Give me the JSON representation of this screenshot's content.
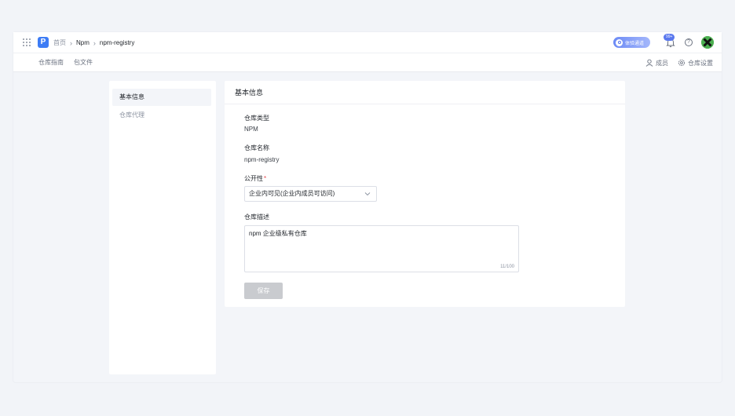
{
  "header": {
    "logo_letter": "P",
    "breadcrumb": [
      "首页",
      "Npm",
      "npm-registry"
    ],
    "pill_label": "体验通道",
    "notification_badge": "99+",
    "help_glyph": "?"
  },
  "tabs": {
    "left": [
      "仓库指南",
      "包文件"
    ],
    "members_label": "成员",
    "settings_label": "仓库设置"
  },
  "sidebar": {
    "items": [
      {
        "label": "基本信息",
        "active": true
      },
      {
        "label": "仓库代理",
        "active": false
      }
    ]
  },
  "main": {
    "title": "基本信息",
    "repo_type_label": "仓库类型",
    "repo_type_value": "NPM",
    "repo_name_label": "仓库名称",
    "repo_name_value": "npm-registry",
    "visibility_label": "公开性",
    "required_mark": "*",
    "visibility_value": "企业内可见(企业内成员可访问)",
    "description_label": "仓库描述",
    "description_value": "npm 企业级私有仓库",
    "description_counter": "11/100",
    "save_label": "保存"
  },
  "colors": {
    "accent": "#5a78ee",
    "background": "#f2f4f8",
    "disabled_button": "#c9cbcf",
    "required": "#e5484d"
  }
}
